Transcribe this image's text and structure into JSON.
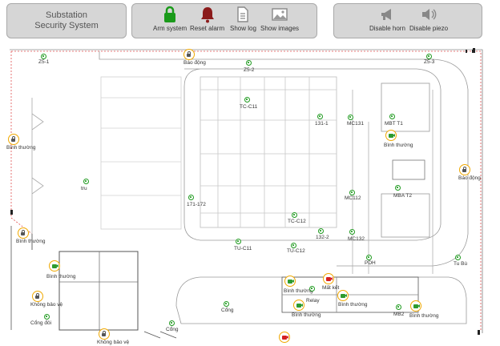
{
  "header": {
    "title_line1": "Substation",
    "title_line2": "Security System"
  },
  "toolbar": {
    "arm": {
      "label": "Arm system",
      "icon": "padlock-icon",
      "color": "#1a9a1a"
    },
    "reset": {
      "label": "Reset alarm",
      "icon": "bell-icon",
      "color": "#8b1a1a"
    },
    "log": {
      "label": "Show log",
      "icon": "document-icon"
    },
    "images": {
      "label": "Show images",
      "icon": "image-icon"
    },
    "horn": {
      "label": "Disable horn",
      "icon": "megaphone-icon"
    },
    "piezo": {
      "label": "Disable piezo",
      "icon": "speaker-icon"
    }
  },
  "map": {
    "labels": {
      "z5_1": "Z5-1",
      "z5_2": "Z5-2",
      "z5_3": "Z5-3",
      "bao_dong_top": "Báo động",
      "bao_dong_right": "Báo động",
      "binh_thuong_left": "Bình thường",
      "binh_thuong_left2": "Bình thường",
      "binh_thuong_cam": "Bình thường",
      "binh_thuong_mbt": "Bình thường",
      "binh_thuong_b1": "Bình thường",
      "binh_thuong_b2": "Bình thường",
      "binh_thuong_b3": "Bình thường",
      "binh_thuong_b4": "Bình thường",
      "tc_c11": "TC-C11",
      "tc_c12": "TC-C12",
      "tu_c11": "TU-C11",
      "tu_c12": "TU-C12",
      "l131_1": "131-1",
      "l132_2": "132-2",
      "l171_172": "171-172",
      "mc131": "MC131",
      "mc112": "MC112",
      "mc132": "MC132",
      "mbt_t1": "MBT T1",
      "mba_t2": "MBA T2",
      "tru": "tru",
      "pdh": "PDH",
      "tu_bu": "Tu Bù",
      "cong": "Cổng",
      "cong2": "Cổng",
      "cong_doi": "Cổng đôi",
      "khong_bao_ve": "Không bảo vệ",
      "khong_bao_ve2": "Không bảo vệ",
      "relay": "Relay",
      "mat_ket_noi": "Mất kết",
      "mb2": "MB2"
    }
  },
  "colors": {
    "panel_bg": "#d6d6d6",
    "sensor_green": "#1e9a1e",
    "alarm_orange": "#f0a800",
    "alert_red": "#d42020",
    "fence_red": "#e05050",
    "line_gray": "#9a9a9a"
  }
}
